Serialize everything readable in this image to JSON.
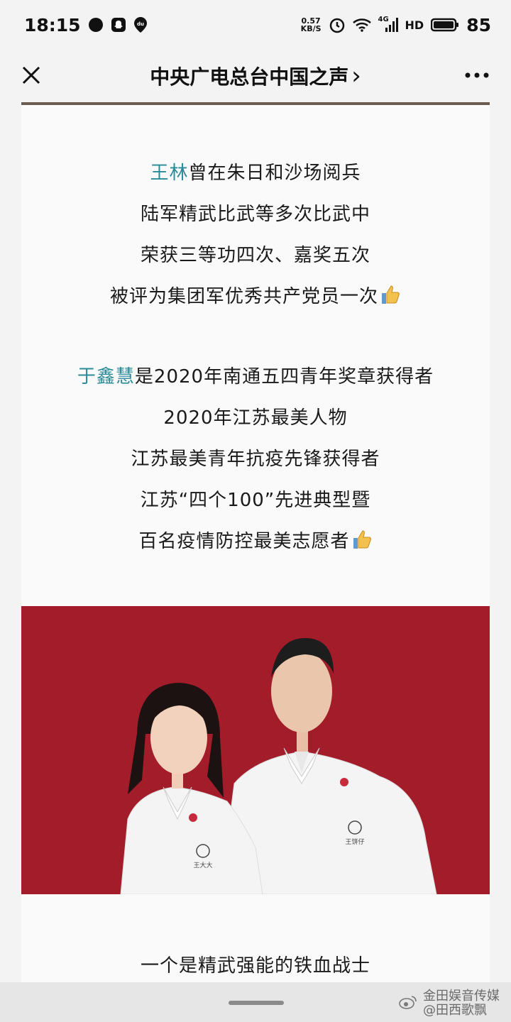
{
  "status_bar": {
    "time": "18:15",
    "net_speed_value": "0.57",
    "net_speed_unit": "KB/S",
    "network_type": "4G",
    "hd_label": "HD",
    "battery_level": "85"
  },
  "nav": {
    "title": "中央广电总台中国之声",
    "title_chevron": "›"
  },
  "article": {
    "para1": {
      "name": "王林",
      "line1_rest": "曾在朱日和沙场阅兵",
      "line2": "陆军精武比武等多次比武中",
      "line3": "荣获三等功四次、嘉奖五次",
      "line4": "被评为集团军优秀共产党员一次"
    },
    "para2": {
      "name": "于鑫慧",
      "line1_rest": "是2020年南通五四青年奖章获得者",
      "line2": "2020年江苏最美人物",
      "line3": "江苏最美青年抗疫先锋获得者",
      "line4": "江苏“四个100”先进典型暨",
      "line5": "百名疫情防控最美志愿者"
    },
    "photo": {
      "background_color": "#a31c2a",
      "shirt_logo_text_left": "王大大",
      "shirt_logo_text_right": "王饼仔"
    },
    "caption": "一个是精武强能的铁血战士"
  },
  "colors": {
    "highlight": "#2a8a98",
    "page_bg": "#f3f3f3"
  },
  "watermark": {
    "line1": "金田娱音传媒",
    "line2": "@田西歌飘"
  }
}
